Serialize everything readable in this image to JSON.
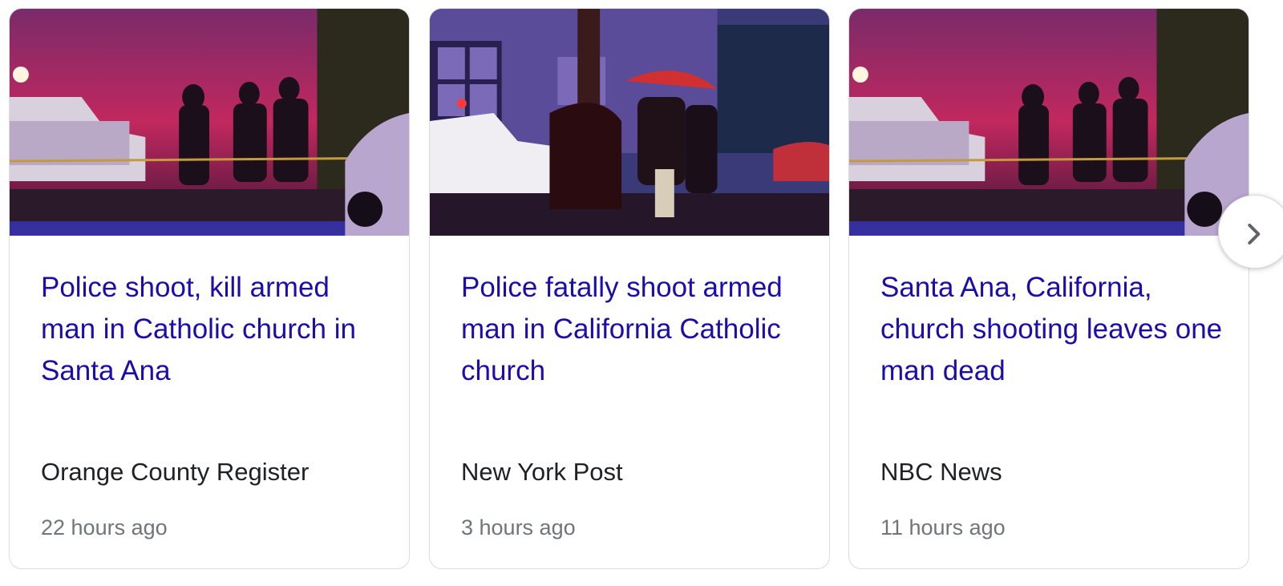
{
  "cards": [
    {
      "headline": "Police shoot, kill armed man in Catholic church in Santa Ana",
      "source": "Orange County Register",
      "time": "22 hours ago"
    },
    {
      "headline": "Police fatally shoot armed man in California Catholic church",
      "source": "New York Post",
      "time": "3 hours ago"
    },
    {
      "headline": "Santa Ana, California, church shooting leaves one man dead",
      "source": "NBC News",
      "time": "11 hours ago"
    }
  ],
  "next_button": {
    "icon": "chevron-right-icon"
  },
  "colors": {
    "headline": "#1a0dab",
    "source": "#202124",
    "time": "#70757a",
    "border": "#dadce0"
  }
}
